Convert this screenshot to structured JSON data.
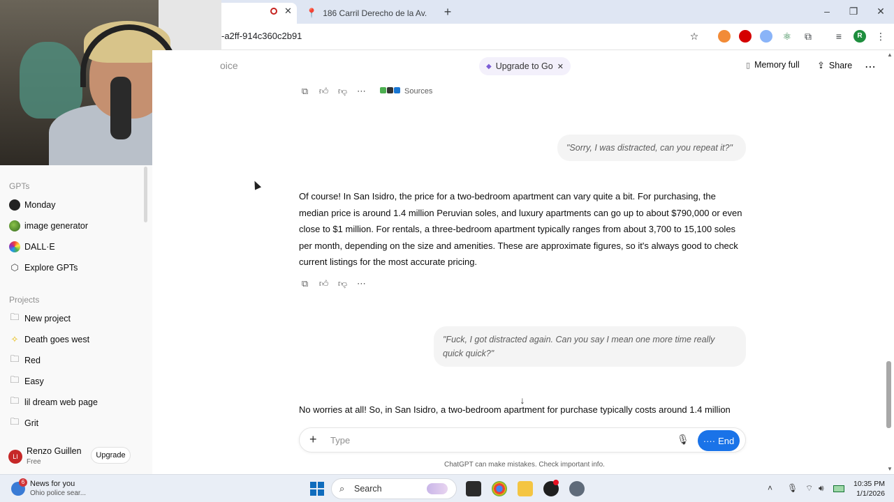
{
  "browser": {
    "tabs": [
      {
        "label": ""
      },
      {
        "label": "186 Carril Derecho de la Av. La"
      }
    ],
    "url": "-a2ff-914c360c2b91",
    "profile_initial": "R"
  },
  "header": {
    "partial_title": "oice",
    "upgrade_label": "Upgrade to Go",
    "memory_label": "Memory full",
    "share_label": "Share"
  },
  "sidebar": {
    "gpts_heading": "GPTs",
    "gpts": [
      {
        "label": "Monday",
        "icon": "monday-icon"
      },
      {
        "label": "image generator",
        "icon": "image-generator-icon"
      },
      {
        "label": "DALL·E",
        "icon": "dalle-icon"
      },
      {
        "label": "Explore GPTs",
        "icon": "explore-cube-icon"
      }
    ],
    "projects_heading": "Projects",
    "projects": [
      {
        "label": "New project",
        "icon": "folder-plus-icon"
      },
      {
        "label": "Death goes west",
        "icon": "star-icon"
      },
      {
        "label": "Red",
        "icon": "folder-icon"
      },
      {
        "label": "Easy",
        "icon": "folder-icon"
      },
      {
        "label": "lil dream web page",
        "icon": "folder-icon"
      },
      {
        "label": "Grit",
        "icon": "folder-icon"
      }
    ],
    "user": {
      "name": "Renzo Guillen",
      "plan": "Free",
      "initials": "LI",
      "upgrade_label": "Upgrade"
    }
  },
  "chat": {
    "sources_label": "Sources",
    "messages": [
      {
        "role": "user",
        "text": "\"Sorry, I was distracted, can you repeat it?\""
      },
      {
        "role": "assistant",
        "text": "Of course! In San Isidro, the price for a two-bedroom apartment can vary quite a bit. For purchasing, the median price is around 1.4 million Peruvian soles, and luxury apartments can go up to about $790,000 or even close to $1 million. For rentals, a three-bedroom apartment typically ranges from about 3,700 to 15,100 soles per month, depending on the size and amenities. These are approximate figures, so it's always good to check current listings for the most accurate pricing."
      },
      {
        "role": "user",
        "text": "\"Fuck, I got distracted again. Can you say I mean one more time really quick quick?\""
      },
      {
        "role": "assistant",
        "text": "No worries at all! So, in San Isidro, a two-bedroom apartment for purchase typically costs around 1.4 million"
      }
    ],
    "composer_placeholder": "Type",
    "end_label": "End",
    "disclaimer": "ChatGPT can make mistakes. Check important info."
  },
  "taskbar": {
    "news_badge": "6",
    "news_title": "News for you",
    "news_sub": "Ohio police sear...",
    "search_label": "Search",
    "time": "10:35 PM",
    "date": "1/1/2026"
  }
}
